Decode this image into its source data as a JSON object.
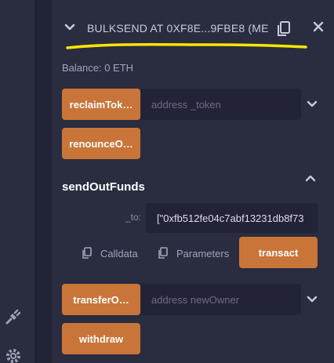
{
  "contract": {
    "title": "BULKSEND AT 0XF8E...9FBE8 (ME",
    "balance": "Balance: 0 ETH"
  },
  "functions": [
    {
      "label": "reclaimTok…",
      "placeholder": "address _token"
    },
    {
      "label": "renounceO…"
    },
    {
      "label": "transferO…",
      "placeholder": "address newOwner"
    },
    {
      "label": "withdraw"
    }
  ],
  "sendOutFunds": {
    "title": "sendOutFunds",
    "param_label": "_to:",
    "param_value": "[\"0xfb512fe04c7abf13231db8f73",
    "calldata_label": "Calldata",
    "parameters_label": "Parameters",
    "transact_label": "transact"
  },
  "icons": [
    "chevron-down-icon",
    "copy-icon",
    "close-icon",
    "chevron-up-icon",
    "plug-icon",
    "gear-icon"
  ],
  "colors": {
    "accent": "#c97539",
    "panel": "#2a2c3f",
    "background": "#222336",
    "highlight": "#f7e600"
  }
}
